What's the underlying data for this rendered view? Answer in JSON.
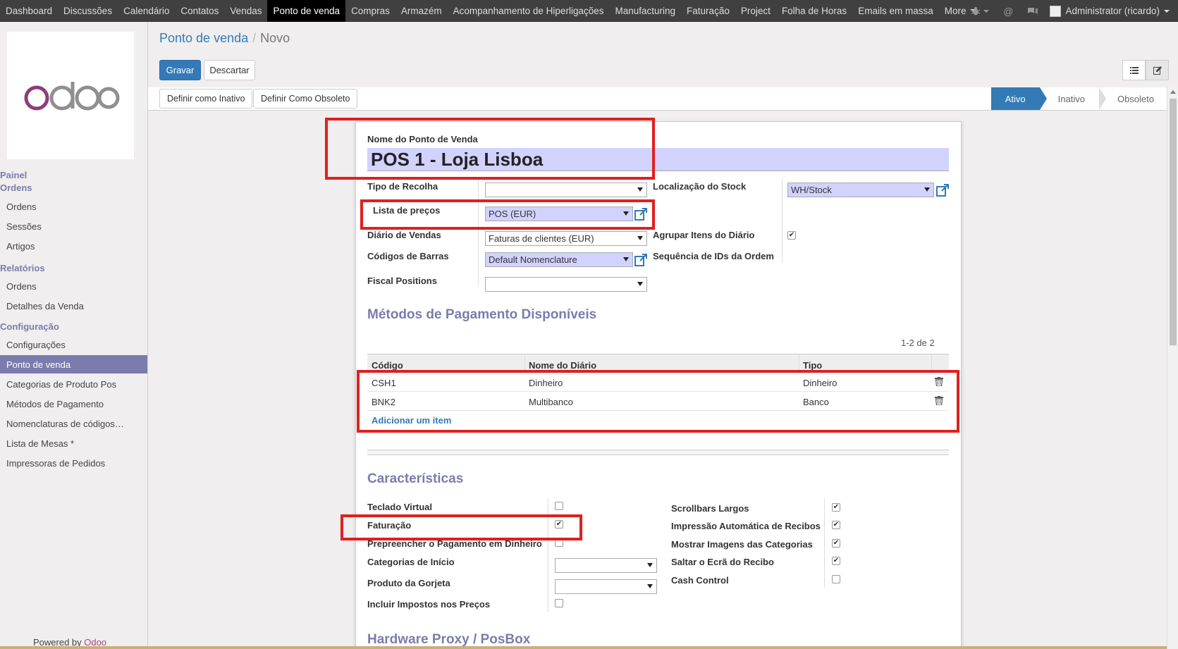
{
  "topbar": {
    "menu": [
      "Dashboard",
      "Discussões",
      "Calendário",
      "Contatos",
      "Vendas",
      "Ponto de venda",
      "Compras",
      "Armazém",
      "Acompanhamento de Hiperligações",
      "Manufacturing",
      "Faturação",
      "Project",
      "Folha de Horas",
      "Emails em massa",
      "More"
    ],
    "active": "Ponto de venda",
    "user": "Administrator (ricardo)"
  },
  "sidebar": {
    "logo_text": "odoo",
    "sections": [
      {
        "title": "Painel"
      },
      {
        "title": "Ordens",
        "items": [
          "Ordens",
          "Sessões",
          "Artigos"
        ]
      },
      {
        "title": "Relatórios",
        "items": [
          "Ordens",
          "Detalhes da Venda"
        ]
      },
      {
        "title": "Configuração",
        "items": [
          "Configurações",
          "Ponto de venda",
          "Categorias de Produto Pos",
          "Métodos de Pagamento",
          "Nomenclaturas de códigos…",
          "Lista de Mesas *",
          "Impressoras de Pedidos"
        ]
      }
    ],
    "active_item": "Ponto de venda",
    "powered_prefix": "Powered by",
    "powered_brand": "Odoo"
  },
  "breadcrumb": {
    "parent": "Ponto de venda",
    "sep": "/",
    "current": "Novo"
  },
  "buttons": {
    "save": "Gravar",
    "discard": "Descartar",
    "set_inactive": "Definir como Inativo",
    "set_obsolete": "Definir Como Obsoleto"
  },
  "stages": [
    "Ativo",
    "Inativo",
    "Obsoleto"
  ],
  "form": {
    "name_label": "Nome do Ponto de Venda",
    "name_value": "POS 1 - Loja Lisboa",
    "picking_type_label": "Tipo de Recolha",
    "picking_type_value": "",
    "stock_location_label": "Localização do Stock",
    "stock_location_value": "WH/Stock",
    "pricelist_label": "Lista de preços",
    "pricelist_value": "POS (EUR)",
    "journal_label": "Diário de Vendas",
    "journal_value": "Faturas de clientes (EUR)",
    "group_items_label": "Agrupar Itens do Diário",
    "group_items_checked": true,
    "barcode_label": "Códigos de Barras",
    "barcode_value": "Default Nomenclature",
    "sequence_label": "Sequência de IDs da Ordem",
    "fiscal_label": "Fiscal Positions",
    "fiscal_value": ""
  },
  "payments": {
    "title": "Métodos de Pagamento Disponíveis",
    "pager": "1-2 de 2",
    "columns": [
      "Código",
      "Nome do Diário",
      "Tipo"
    ],
    "rows": [
      {
        "code": "CSH1",
        "journal": "Dinheiro",
        "type": "Dinheiro"
      },
      {
        "code": "BNK2",
        "journal": "Multibanco",
        "type": "Banco"
      }
    ],
    "add_item": "Adicionar um item"
  },
  "features": {
    "title": "Características",
    "left": [
      {
        "label": "Teclado Virtual",
        "checked": false
      },
      {
        "label": "Faturação",
        "checked": true
      },
      {
        "label": "Prepreencher o Pagamento em Dinheiro",
        "checked": false
      }
    ],
    "start_categ_label": "Categorias de Início",
    "tip_product_label": "Produto da Gorjeta",
    "tax_included_label": "Incluir Impostos nos Preços",
    "tax_included_checked": false,
    "right": [
      {
        "label": "Scrollbars Largos",
        "checked": true
      },
      {
        "label": "Impressão Automática de Recibos",
        "checked": true
      },
      {
        "label": "Mostrar Imagens das Categorias",
        "checked": true
      },
      {
        "label": "Saltar o Ecrã do Recibo",
        "checked": true
      },
      {
        "label": "Cash Control",
        "checked": false
      }
    ]
  },
  "hardware_title": "Hardware Proxy / PosBox",
  "colors": {
    "brand": "#7c7bad",
    "primary": "#337ab7",
    "annotation": "#e0201f"
  }
}
